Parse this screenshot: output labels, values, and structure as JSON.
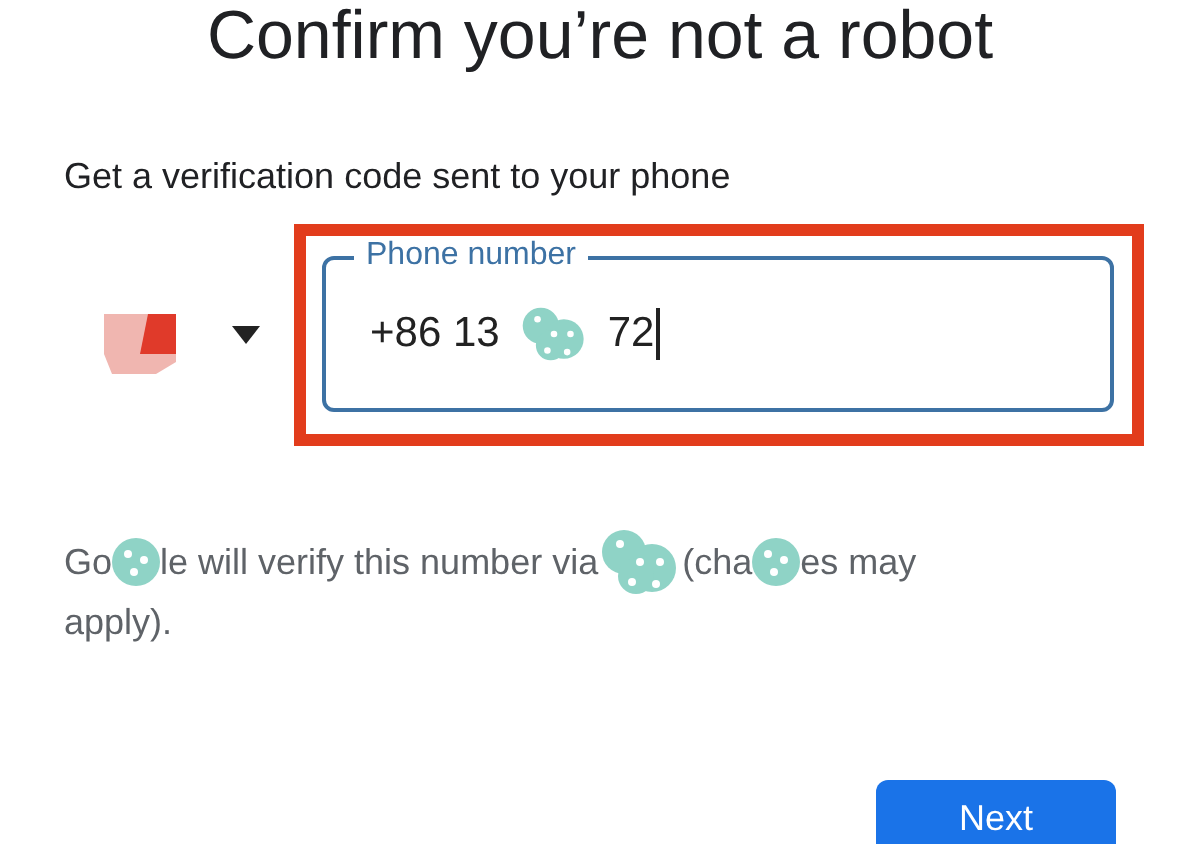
{
  "title": "Confirm you’re not a robot",
  "subtitle": "Get a verification code sent to your phone",
  "country_selector": {
    "expanded": false
  },
  "phone_field": {
    "label": "Phone number",
    "focused": true,
    "highlighted": true,
    "value_parts": [
      {
        "kind": "text",
        "text": "+86 13"
      },
      {
        "kind": "redaction"
      },
      {
        "kind": "text",
        "text": "72"
      }
    ]
  },
  "notice": {
    "lines": [
      [
        {
          "kind": "text",
          "text": "Go"
        },
        {
          "kind": "redaction"
        },
        {
          "kind": "text",
          "text": "le will verify this number via"
        },
        {
          "kind": "redaction"
        },
        {
          "kind": "text",
          "text": "(cha"
        },
        {
          "kind": "redaction"
        },
        {
          "kind": "text",
          "text": "es may"
        }
      ],
      [
        {
          "kind": "text",
          "text": "apply)."
        }
      ]
    ]
  },
  "buttons": [
    {
      "label": "Next"
    }
  ]
}
